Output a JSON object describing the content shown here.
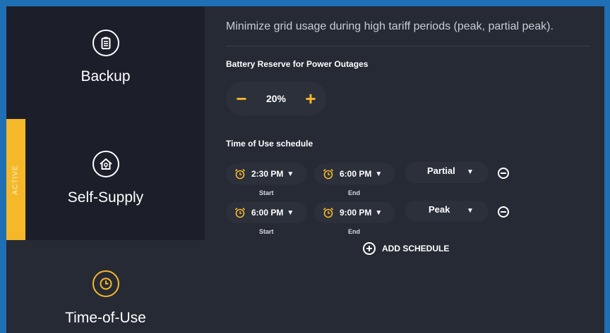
{
  "colors": {
    "accent": "#f5b82a",
    "frame": "#1e6fb3",
    "background": "#262a34",
    "sidebar_selected": "#1c1f2a",
    "pill": "#2c303b"
  },
  "sidebar": {
    "items": [
      {
        "label": "Backup",
        "icon": "battery-icon"
      },
      {
        "label": "Self-Supply",
        "icon": "home-plug-icon",
        "badge": "ACTIVE"
      },
      {
        "label": "Time-of-Use",
        "icon": "clock-icon"
      }
    ]
  },
  "main": {
    "description": "Minimize grid usage during high tariff periods (peak, partial peak).",
    "reserve": {
      "title": "Battery Reserve for Power Outages",
      "value": "20%",
      "decrement": "−",
      "increment": "+"
    },
    "schedule": {
      "title": "Time of Use schedule",
      "start_label": "Start",
      "end_label": "End",
      "rows": [
        {
          "start": "2:30 PM",
          "end": "6:00 PM",
          "period": "Partial"
        },
        {
          "start": "6:00 PM",
          "end": "9:00 PM",
          "period": "Peak"
        }
      ],
      "add_label": "ADD SCHEDULE"
    }
  }
}
